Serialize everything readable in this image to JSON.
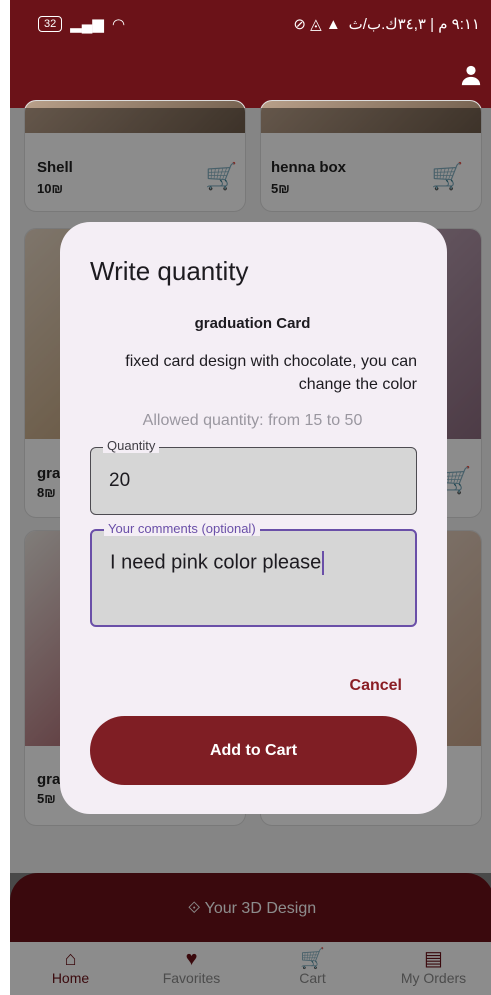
{
  "status_bar": {
    "battery": "32",
    "time": "٩:١١ م | ٣٤,٣ك.ب/ث"
  },
  "products": [
    {
      "name": "Shell",
      "price": "10₪"
    },
    {
      "name": "henna box",
      "price": "5₪"
    },
    {
      "name": "gra",
      "price": "8₪"
    },
    {
      "name": "gra",
      "price": "5₪"
    }
  ],
  "dialog": {
    "title": "Write quantity",
    "product_name": "graduation Card",
    "product_description": "fixed card design with chocolate, you can change the color",
    "allowed_quantity": "Allowed quantity: from 15 to 50",
    "quantity_label": "Quantity",
    "quantity_value": "20",
    "comments_label": "Your comments (optional)",
    "comments_value": "I need pink color please",
    "cancel_label": "Cancel",
    "add_label": "Add to Cart"
  },
  "design_button": {
    "label": "Your 3D Design",
    "icon": "cube-scan-icon"
  },
  "bottom_nav": [
    {
      "label": "Home",
      "icon": "home-icon",
      "active": true
    },
    {
      "label": "Favorites",
      "icon": "heart-icon",
      "active": false
    },
    {
      "label": "Cart",
      "icon": "cart-icon",
      "active": false
    },
    {
      "label": "My Orders",
      "icon": "orders-icon",
      "active": false
    }
  ],
  "colors": {
    "primary": "#6b1218",
    "button": "#7f1e24",
    "focus": "#6a4fa8",
    "dialog_bg": "#f4eef5"
  }
}
